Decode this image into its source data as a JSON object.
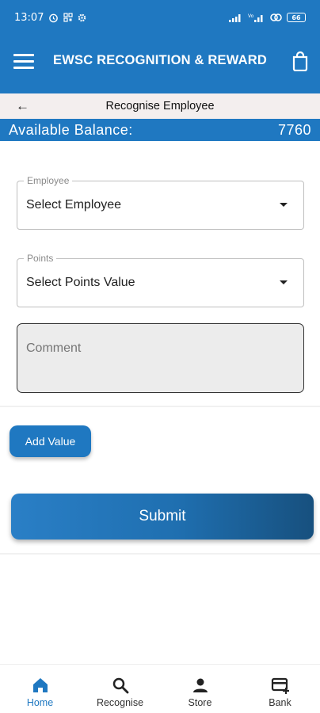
{
  "status_bar": {
    "time": "13:07",
    "battery": "66",
    "network": "Vo LTE"
  },
  "app_bar": {
    "title": "EWSC RECOGNITION & REWARD",
    "menu_icon": "hamburger-menu-icon",
    "cart_icon": "shopping-bag-icon"
  },
  "sub_header": {
    "back_icon": "arrow-left-icon",
    "title": "Recognise Employee"
  },
  "balance": {
    "label": "Available Balance:",
    "value": "7760"
  },
  "form": {
    "employee": {
      "legend": "Employee",
      "value": "Select Employee"
    },
    "points": {
      "legend": "Points",
      "value": "Select Points Value"
    },
    "comment": {
      "placeholder": "Comment"
    },
    "add_value_label": "Add Value",
    "submit_label": "Submit"
  },
  "bottom_nav": {
    "items": [
      {
        "label": "Home",
        "icon": "home-icon",
        "active": true
      },
      {
        "label": "Recognise",
        "icon": "search-icon",
        "active": false
      },
      {
        "label": "Store",
        "icon": "person-icon",
        "active": false
      },
      {
        "label": "Bank",
        "icon": "card-plus-icon",
        "active": false
      }
    ]
  },
  "colors": {
    "primary": "#1f78c1",
    "sub_header_bg": "#f3eeee",
    "active_nav": "#1f78c1"
  }
}
